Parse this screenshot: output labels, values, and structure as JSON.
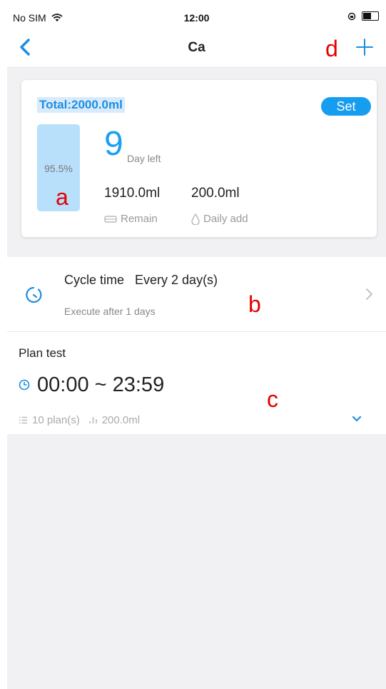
{
  "status_bar": {
    "carrier": "No SIM",
    "time": "12:00"
  },
  "nav": {
    "title": "Ca"
  },
  "annotations": {
    "a": "a",
    "b": "b",
    "c": "c",
    "d": "d"
  },
  "card": {
    "total": "Total:2000.0ml",
    "set_label": "Set",
    "fill_percent_label": "95.5%",
    "fill_fraction": 0.955,
    "days_left_value": "9",
    "days_left_label": "Day left",
    "remain_value": "1910.0ml",
    "remain_label": "Remain",
    "daily_add_value": "200.0ml",
    "daily_add_label": "Daily add"
  },
  "cycle": {
    "title": "Cycle time   Every 2 day(s)",
    "subtitle": "Execute after 1 days"
  },
  "plan": {
    "title": "Plan test",
    "time_range": "00:00 ~ 23:59",
    "plan_count": "10 plan(s)",
    "amount": "200.0ml"
  },
  "colors": {
    "accent": "#179df0",
    "tank_fill": "#b9e0fb",
    "annotation": "#e30000"
  },
  "icons": [
    "back-chevron-icon",
    "plus-icon",
    "wifi-icon",
    "lock-rotation-icon",
    "battery-icon",
    "tray-icon",
    "droplet-icon",
    "timer-icon",
    "chevron-right-icon",
    "clock-icon",
    "list-icon",
    "bar-chart-icon",
    "chevron-down-icon"
  ]
}
